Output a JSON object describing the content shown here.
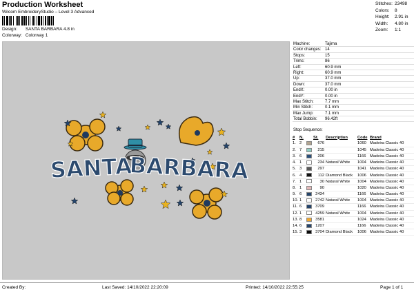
{
  "header": {
    "title": "Production Worksheet",
    "subtitle": "Wilcom EmbroideryStudio – Level 3 Advanced",
    "design_label": "Design:",
    "design_value": "SANTA BARBARA 4.8 in",
    "colorway_label": "Colorway:",
    "colorway_value": "Colorway 1"
  },
  "stats": [
    {
      "k": "Stitches:",
      "v": "23498"
    },
    {
      "k": "Colors:",
      "v": "8"
    },
    {
      "k": "Height:",
      "v": "2.91 in"
    },
    {
      "k": "Width:",
      "v": "4.80 in"
    },
    {
      "k": "Zoom:",
      "v": "1:1"
    }
  ],
  "design": {
    "word1": "SANTA",
    "word2": "BARBARA",
    "colors": {
      "text_fill": "#2c4a6e",
      "text_outline": "#ffffff",
      "flower": "#e8a92a",
      "flower_center": "#1f3a5f",
      "star_gold": "#e9b21f",
      "star_blue": "#24446b",
      "hat": "#2f8fa6"
    }
  },
  "info": [
    {
      "k": "Machine:",
      "v": "Tajima"
    },
    {
      "k": "Color changes:",
      "v": "14"
    },
    {
      "k": "Stops:",
      "v": "15"
    },
    {
      "k": "Trims:",
      "v": "86"
    },
    {
      "k": "Left:",
      "v": "60.9 mm"
    },
    {
      "k": "Right:",
      "v": "60.9 mm"
    },
    {
      "k": "Up:",
      "v": "37.0 mm"
    },
    {
      "k": "Down:",
      "v": "37.0 mm"
    },
    {
      "k": "EndX:",
      "v": "0.00 in"
    },
    {
      "k": "EndY:",
      "v": "0.00 in"
    },
    {
      "k": "Max Stitch:",
      "v": "7.7 mm"
    },
    {
      "k": "Min Stitch:",
      "v": "0.1 mm"
    },
    {
      "k": "Max Jump:",
      "v": "7.1 mm"
    },
    {
      "k": "Total Bobbin:",
      "v": "96.42ft"
    }
  ],
  "sequence": {
    "label": "Stop Sequence:",
    "headers": [
      "#",
      "N.",
      "",
      "St.",
      "Description",
      "Code",
      "Brand"
    ],
    "rows": [
      {
        "n": "1.",
        "no": "2",
        "color": "#b3a591",
        "st": "676",
        "desc": "",
        "code": "1060",
        "brand": "Madeira Classic 40"
      },
      {
        "n": "2.",
        "no": "7",
        "color": "#8fcfc4",
        "st": "215",
        "desc": "",
        "code": "1045",
        "brand": "Madeira Classic 40"
      },
      {
        "n": "3.",
        "no": "6",
        "color": "#2a4f7a",
        "st": "206",
        "desc": "",
        "code": "1166",
        "brand": "Madeira Classic 40"
      },
      {
        "n": "4.",
        "no": "1",
        "color": "#ffffff",
        "st": "234",
        "desc": "Natural White",
        "code": "1004",
        "brand": "Madeira Classic 40"
      },
      {
        "n": "5.",
        "no": "3",
        "color": "#585858",
        "st": "297",
        "desc": "",
        "code": "1041",
        "brand": "Madeira Classic 40"
      },
      {
        "n": "6.",
        "no": "4",
        "color": "#111111",
        "st": "112",
        "desc": "Diamond Black",
        "code": "1006",
        "brand": "Madeira Classic 40"
      },
      {
        "n": "7.",
        "no": "1",
        "color": "#ffffff",
        "st": "30",
        "desc": "Natural White",
        "code": "1004",
        "brand": "Madeira Classic 40"
      },
      {
        "n": "8.",
        "no": "1",
        "color": "#e3b8b8",
        "st": "90",
        "desc": "",
        "code": "1020",
        "brand": "Madeira Classic 40"
      },
      {
        "n": "9.",
        "no": "6",
        "color": "#24446b",
        "st": "2434",
        "desc": "",
        "code": "1166",
        "brand": "Madeira Classic 40"
      },
      {
        "n": "10.",
        "no": "1",
        "color": "#ffffff",
        "st": "2742",
        "desc": "Natural White",
        "code": "1004",
        "brand": "Madeira Classic 40"
      },
      {
        "n": "11.",
        "no": "6",
        "color": "#24446b",
        "st": "3709",
        "desc": "",
        "code": "1166",
        "brand": "Madeira Classic 40"
      },
      {
        "n": "12.",
        "no": "1",
        "color": "#ffffff",
        "st": "4259",
        "desc": "Natural White",
        "code": "1004",
        "brand": "Madeira Classic 40"
      },
      {
        "n": "13.",
        "no": "8",
        "color": "#f0a830",
        "st": "3581",
        "desc": "",
        "code": "1024",
        "brand": "Madeira Classic 40"
      },
      {
        "n": "14.",
        "no": "6",
        "color": "#24446b",
        "st": "1207",
        "desc": "",
        "code": "1166",
        "brand": "Madeira Classic 40"
      },
      {
        "n": "15.",
        "no": "3",
        "color": "#0a0a0a",
        "st": "3704",
        "desc": "Diamond Black",
        "code": "1006",
        "brand": "Madeira Classic 40"
      }
    ]
  },
  "footer": {
    "created": "Created By:",
    "last_saved": "Last Saved: 14/10/2022 22:20:09",
    "printed": "Printed: 14/10/2022 22:55:25",
    "page": "Page 1 of 1"
  }
}
